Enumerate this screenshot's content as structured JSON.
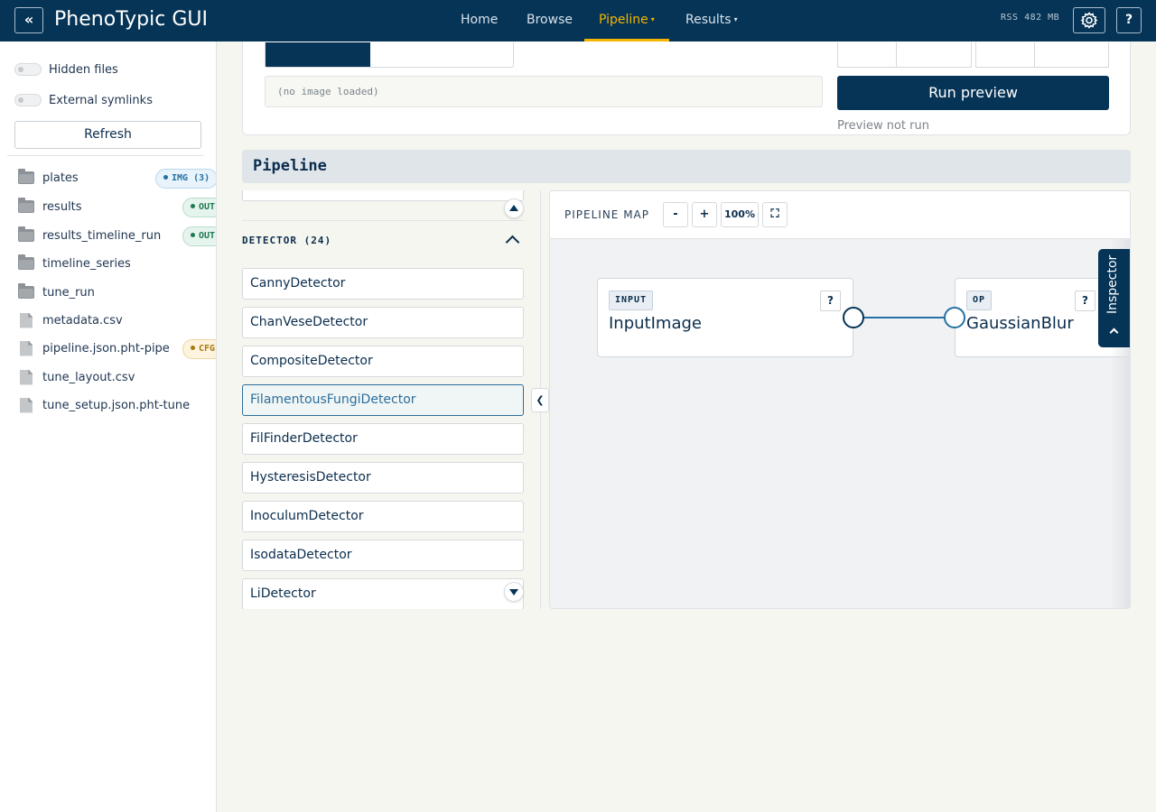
{
  "header": {
    "collapse_icon": "«",
    "title": "PhenoTypic GUI",
    "nav": [
      {
        "label": "Home",
        "active": false,
        "dropdown": false
      },
      {
        "label": "Browse",
        "active": false,
        "dropdown": false
      },
      {
        "label": "Pipeline",
        "active": true,
        "dropdown": true
      },
      {
        "label": "Results",
        "active": false,
        "dropdown": true
      }
    ],
    "caret": "▾",
    "rss": "RSS 482 MB",
    "help_label": "?"
  },
  "sidebar": {
    "toggles": [
      {
        "label": "Hidden files",
        "on": false
      },
      {
        "label": "External symlinks",
        "on": false
      }
    ],
    "refresh_label": "Refresh",
    "files": [
      {
        "name": "plates",
        "type": "folder",
        "badge": "IMG (3)",
        "badge_kind": "img"
      },
      {
        "name": "results",
        "type": "folder",
        "badge": "OUT",
        "badge_kind": "out"
      },
      {
        "name": "results_timeline_run",
        "type": "folder",
        "badge": "OUT",
        "badge_kind": "out"
      },
      {
        "name": "timeline_series",
        "type": "folder",
        "badge": "",
        "badge_kind": ""
      },
      {
        "name": "tune_run",
        "type": "folder",
        "badge": "",
        "badge_kind": ""
      },
      {
        "name": "metadata.csv",
        "type": "file",
        "badge": "",
        "badge_kind": ""
      },
      {
        "name": "pipeline.json.pht-pipe",
        "type": "file",
        "badge": "CFG",
        "badge_kind": "cfg"
      },
      {
        "name": "tune_layout.csv",
        "type": "file",
        "badge": "",
        "badge_kind": ""
      },
      {
        "name": "tune_setup.json.pht-tune",
        "type": "file",
        "badge": "",
        "badge_kind": ""
      }
    ]
  },
  "preview": {
    "image_field": "(no image loaded)",
    "run_label": "Run preview",
    "status": "Preview not run"
  },
  "pipeline": {
    "section_title": "Pipeline",
    "group_header": "DETECTOR (24)",
    "operations": [
      {
        "label": "CannyDetector",
        "selected": false
      },
      {
        "label": "ChanVeseDetector",
        "selected": false
      },
      {
        "label": "CompositeDetector",
        "selected": false
      },
      {
        "label": "FilamentousFungiDetector",
        "selected": true
      },
      {
        "label": "FilFinderDetector",
        "selected": false
      },
      {
        "label": "HysteresisDetector",
        "selected": false
      },
      {
        "label": "InoculumDetector",
        "selected": false
      },
      {
        "label": "IsodataDetector",
        "selected": false
      },
      {
        "label": "LiDetector",
        "selected": false
      }
    ],
    "collapse_label": "❮",
    "map": {
      "title": "PIPELINE MAP",
      "zoom_out": "-",
      "zoom_in": "+",
      "zoom": "100%",
      "fit": "⛶",
      "nodes": [
        {
          "tag": "INPUT",
          "title": "InputImage",
          "help": "?"
        },
        {
          "tag": "OP",
          "title": "GaussianBlur",
          "help": "?"
        }
      ],
      "inspector_label": "Inspector"
    }
  },
  "colors": {
    "primary": "#063456",
    "accent": "#f5b400",
    "link": "#2571a5"
  }
}
